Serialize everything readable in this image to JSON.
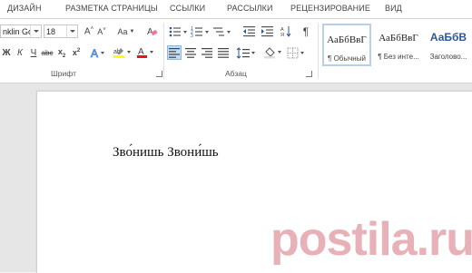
{
  "tabs": [
    "ДИЗАЙН",
    "РАЗМЕТКА СТРАНИЦЫ",
    "ССЫЛКИ",
    "РАССЫЛКИ",
    "РЕЦЕНЗИРОВАНИЕ",
    "ВИД"
  ],
  "font": {
    "family_value": "nklin Gotl",
    "size_value": "18",
    "group_label": "Шрифт",
    "bold": "Ж",
    "italic": "К",
    "case_label": "Aa"
  },
  "paragraph": {
    "group_label": "Абзац"
  },
  "styles": [
    {
      "preview": "АаБбВвГ",
      "name": "¶ Обычный"
    },
    {
      "preview": "АаБбВвГ",
      "name": "¶ Без инте..."
    },
    {
      "preview": "АаБбВ",
      "name": "Заголово..."
    }
  ],
  "document": {
    "text": "Зво́нишь Звони́шь"
  },
  "watermark": "postila.ru",
  "colors": {
    "accent": "#2b579a",
    "watermark": "#d4737e",
    "font_color": "#e81123",
    "highlight": "#ffff00"
  }
}
